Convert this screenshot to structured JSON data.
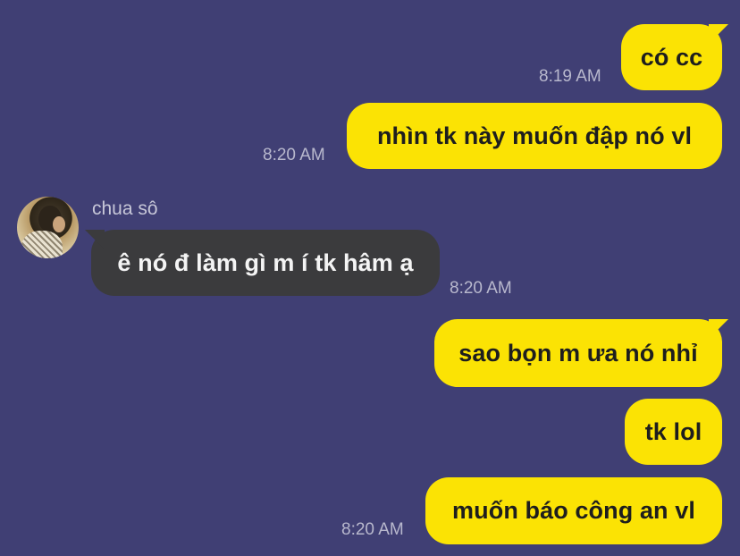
{
  "colors": {
    "background": "#403f74",
    "outgoing_bubble": "#fbe304",
    "incoming_bubble": "#3b3b3d",
    "timestamp": "#b8b8cd"
  },
  "messages": [
    {
      "direction": "outgoing",
      "text": "có cc",
      "time": "8:19 AM"
    },
    {
      "direction": "outgoing",
      "text": "nhìn tk này muốn đập nó vl",
      "time": "8:20 AM"
    },
    {
      "direction": "incoming",
      "sender": "chua sô",
      "avatar": "avatar-photo",
      "text": "ê nó đ làm gì m í tk hâm ạ",
      "time": "8:20 AM"
    },
    {
      "direction": "outgoing",
      "text": "sao bọn m ưa nó nhỉ"
    },
    {
      "direction": "outgoing",
      "text": "tk lol"
    },
    {
      "direction": "outgoing",
      "text": "muốn báo công an vl",
      "time": "8:20 AM"
    }
  ]
}
